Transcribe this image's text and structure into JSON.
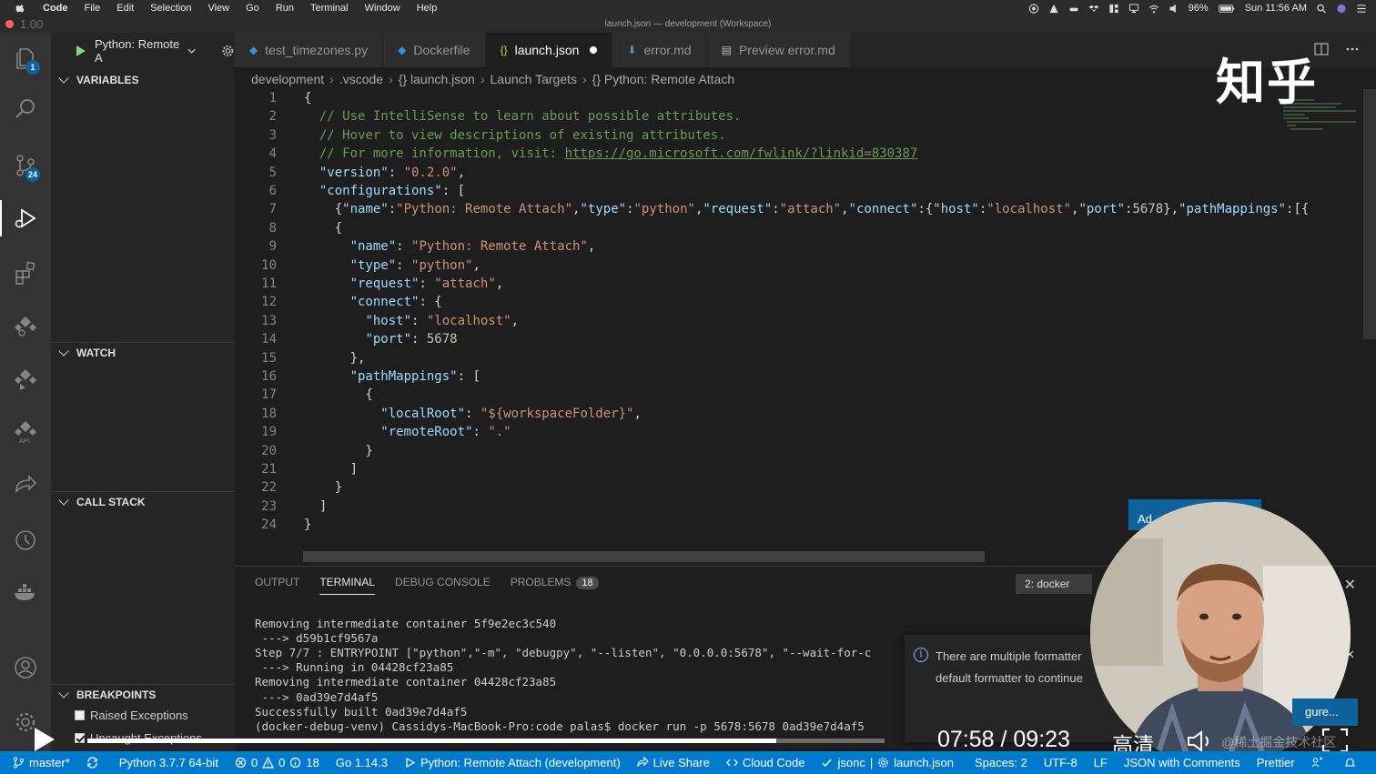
{
  "menubar": {
    "app": "Code",
    "items": [
      "File",
      "Edit",
      "Selection",
      "View",
      "Go",
      "Run",
      "Terminal",
      "Window",
      "Help"
    ],
    "battery": "96%",
    "clock": "Sun 11:56 AM"
  },
  "window": {
    "title": "launch.json — development (Workspace)",
    "zoom_label": "1.00"
  },
  "activity_bar": {
    "explorer_badge": "1",
    "scm_badge": "24"
  },
  "sidebar": {
    "debug_config": "Python: Remote A",
    "sections": {
      "variables": "VARIABLES",
      "watch": "WATCH",
      "call_stack": "CALL STACK",
      "breakpoints": "BREAKPOINTS"
    },
    "breakpoints": [
      {
        "label": "Raised Exceptions",
        "checked": false
      },
      {
        "label": "Uncaught Exceptions",
        "checked": true
      }
    ]
  },
  "tabs": [
    {
      "label": "test_timezones.py",
      "icon": "python-icon",
      "active": false
    },
    {
      "label": "Dockerfile",
      "icon": "docker-icon",
      "active": false
    },
    {
      "label": "launch.json",
      "icon": "json-icon",
      "active": true,
      "dirty": true
    },
    {
      "label": "error.md",
      "icon": "markdown-icon",
      "active": false
    },
    {
      "label": "Preview error.md",
      "icon": "preview-icon",
      "active": false
    }
  ],
  "breadcrumb": [
    "development",
    ".vscode",
    "{} launch.json",
    "Launch Targets",
    "{} Python: Remote Attach"
  ],
  "editor": {
    "lines": [
      "{",
      "  // Use IntelliSense to learn about possible attributes.",
      "  // Hover to view descriptions of existing attributes.",
      "  // For more information, visit: https://go.microsoft.com/fwlink/?linkid=830387",
      "  \"version\": \"0.2.0\",",
      "  \"configurations\": [",
      "    {\"name\":\"Python: Remote Attach\",\"type\":\"python\",\"request\":\"attach\",\"connect\":{\"host\":\"localhost\",\"port\":5678},\"pathMappings\":[{",
      "    {",
      "      \"name\": \"Python: Remote Attach\",",
      "      \"type\": \"python\",",
      "      \"request\": \"attach\",",
      "      \"connect\": {",
      "        \"host\": \"localhost\",",
      "        \"port\": 5678",
      "      },",
      "      \"pathMappings\": [",
      "        {",
      "          \"localRoot\": \"${workspaceFolder}\",",
      "          \"remoteRoot\": \".\"",
      "        }",
      "      ]",
      "    }",
      "  ]",
      "}"
    ]
  },
  "watermark": "知乎",
  "panel": {
    "tabs": [
      "OUTPUT",
      "TERMINAL",
      "DEBUG CONSOLE",
      "PROBLEMS"
    ],
    "active_tab": "TERMINAL",
    "problems_count": "18",
    "terminal_select": "2: docker",
    "terminal_lines": [
      "Removing intermediate container 5f9e2ec3c540",
      " ---> d59b1cf9567a",
      "Step 7/7 : ENTRYPOINT [\"python\",\"-m\", \"debugpy\", \"--listen\", \"0.0.0.0:5678\", \"--wait-for-c",
      " ---> Running in 04428cf23a85",
      "Removing intermediate container 04428cf23a85",
      " ---> 0ad39e7d4af5",
      "Successfully built 0ad39e7d4af5",
      "(docker-debug-venv) Cassidys-MacBook-Pro:code palas$ docker run -p 5678:5678 0ad39e7d4af5 "
    ]
  },
  "notification": {
    "line1": "There are multiple formatter",
    "line2": "default formatter to continue",
    "action_partial_top": "Ad",
    "action_partial_bottom": "gure..."
  },
  "video": {
    "time": "07:58 / 09:23",
    "quality": "高清",
    "watermark": "@稀土掘金技术社区",
    "progress": 0.864
  },
  "statusbar": {
    "branch": "master*",
    "python": "Python 3.7.7 64-bit",
    "errors": "0",
    "warnings": "0",
    "infos": "18",
    "go": "Go 1.14.3",
    "debug_target": "Python: Remote Attach (development)",
    "live_share": "Live Share",
    "cloud_code": "Cloud Code",
    "language_mode": "jsonc",
    "file": "launch.json",
    "spaces": "Spaces: 2",
    "encoding": "UTF-8",
    "eol": "LF",
    "language": "JSON with Comments",
    "prettier": "Prettier"
  }
}
